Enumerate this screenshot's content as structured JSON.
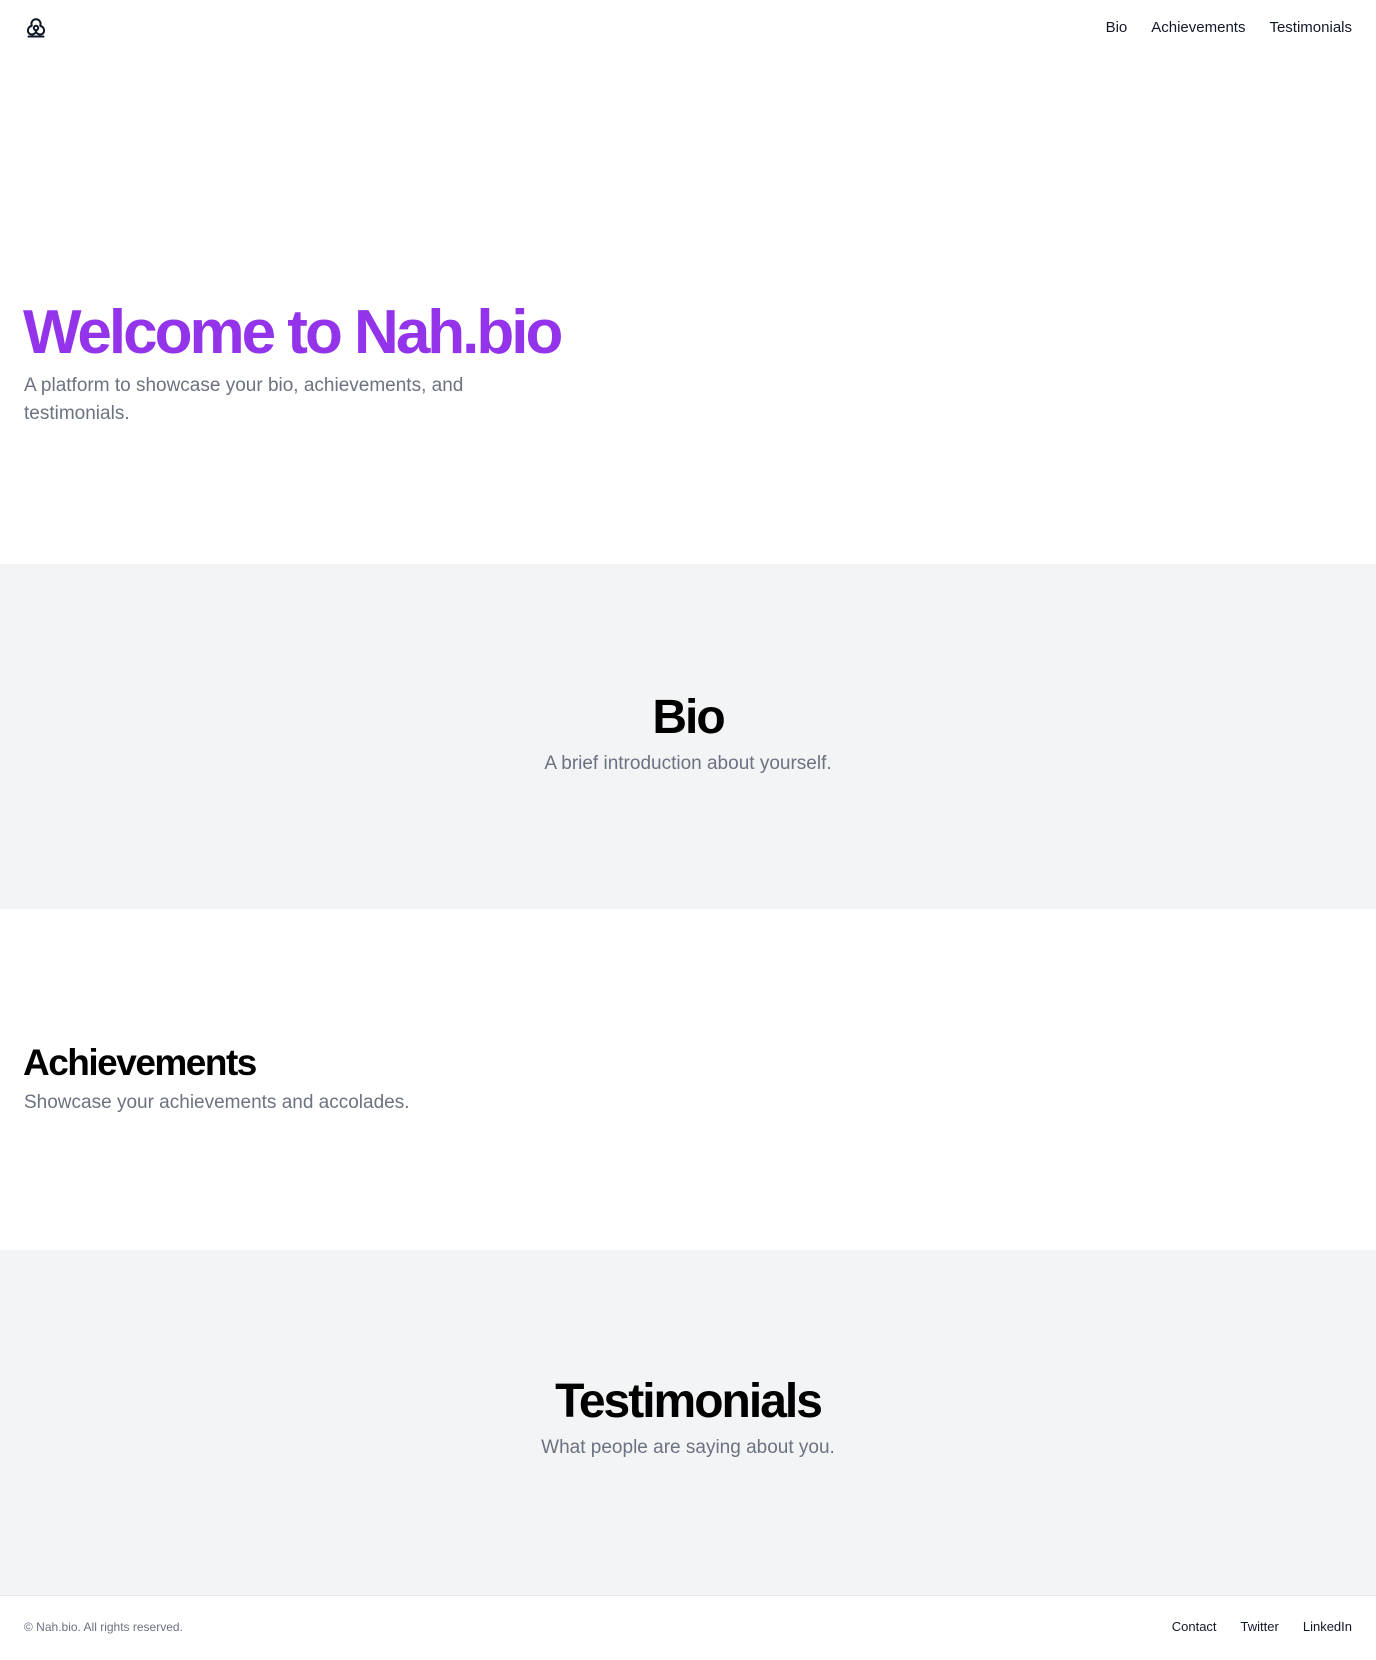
{
  "header": {
    "logo_icon": "biohazard-icon",
    "nav": [
      "Bio",
      "Achievements",
      "Testimonials"
    ]
  },
  "hero": {
    "title": "Welcome to Nah.bio",
    "subtitle": "A platform to showcase your bio, achievements, and testimonials."
  },
  "bio": {
    "title": "Bio",
    "subtitle": "A brief introduction about yourself."
  },
  "achievements": {
    "title": "Achievements",
    "subtitle": "Showcase your achievements and accolades."
  },
  "testimonials": {
    "title": "Testimonials",
    "subtitle": "What people are saying about you."
  },
  "footer": {
    "copyright": "© Nah.bio. All rights reserved.",
    "links": [
      "Contact",
      "Twitter",
      "LinkedIn"
    ]
  },
  "colors": {
    "accent": "#9333ea",
    "muted_text": "#6b7280",
    "section_gray": "#f3f4f6"
  }
}
